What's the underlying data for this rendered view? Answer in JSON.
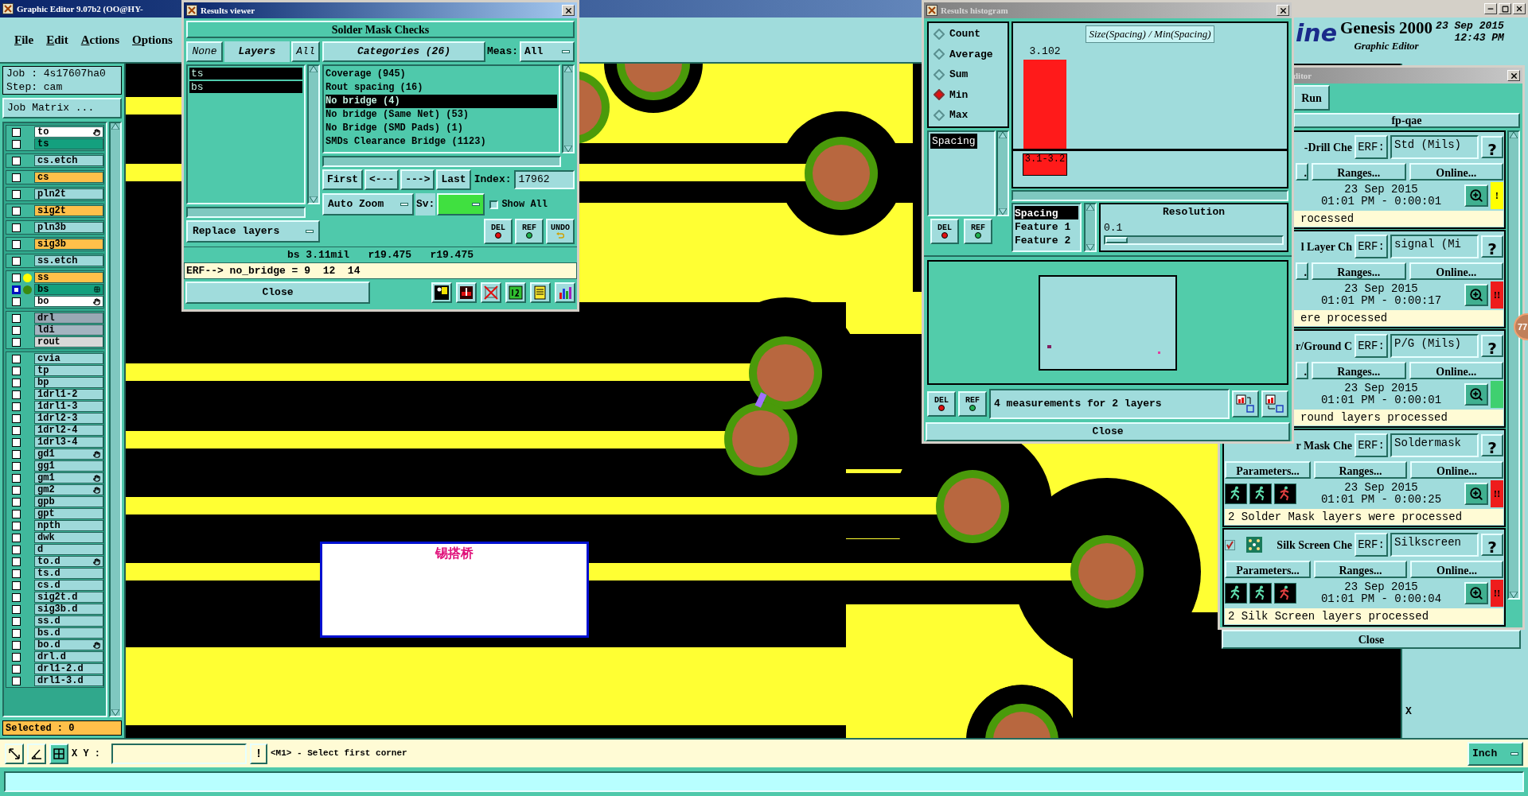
{
  "main_window": {
    "title": "Graphic Editor 9.07b2 (OO@HY-",
    "menu": [
      "File",
      "Edit",
      "Actions",
      "Options"
    ]
  },
  "left_panel": {
    "job": "Job : 4s17607ha0",
    "step": "Step: cam",
    "job_matrix_button": "Job Matrix ...",
    "layer_groups": [
      {
        "layers": [
          {
            "name": "to",
            "color": "#ffffff",
            "hand_mark": true,
            "selected": false
          },
          {
            "name": "ts",
            "color": "#14a07e",
            "selected": false
          }
        ]
      },
      {
        "layers": [
          {
            "name": "cs.etch",
            "color": "#9ed9da",
            "selected": false
          }
        ]
      },
      {
        "layers": [
          {
            "name": "cs",
            "color": "#ffc04a",
            "selected": false
          }
        ]
      },
      {
        "layers": [
          {
            "name": "pln2t",
            "color": "#9ed9da",
            "selected": false
          }
        ]
      },
      {
        "layers": [
          {
            "name": "sig2t",
            "color": "#ffc04a",
            "selected": false
          }
        ]
      },
      {
        "layers": [
          {
            "name": "pln3b",
            "color": "#9ed9da",
            "selected": false
          }
        ]
      },
      {
        "layers": [
          {
            "name": "sig3b",
            "color": "#ffc04a",
            "selected": false
          }
        ]
      },
      {
        "layers": [
          {
            "name": "ss.etch",
            "color": "#9ed9da",
            "selected": false
          }
        ]
      },
      {
        "layers": [
          {
            "name": "ss",
            "color": "#ffc04a",
            "dot": {
              "color": "#ffff00"
            },
            "selected": false
          },
          {
            "name": "bs",
            "color": "#14a07e",
            "dot": {
              "color": "#3a8a10"
            },
            "grid_mark": true,
            "selected": true
          },
          {
            "name": "bo",
            "color": "#ffffff",
            "hand_mark": true,
            "selected": false
          }
        ]
      },
      {
        "layers": [
          {
            "name": "drl",
            "color": "#98a8b4",
            "selected": false
          },
          {
            "name": "ldi",
            "color": "#a4b4c0",
            "selected": false
          },
          {
            "name": "rout",
            "color": "#d8d8d8",
            "selected": false
          }
        ]
      },
      {
        "layers": [
          {
            "name": "cvia",
            "color": "#9ed9da",
            "selected": false
          },
          {
            "name": "tp",
            "color": "#9ed9da",
            "selected": false
          },
          {
            "name": "bp",
            "color": "#9ed9da",
            "selected": false
          },
          {
            "name": "1drl1-2",
            "color": "#9ed9da",
            "selected": false
          },
          {
            "name": "1drl1-3",
            "color": "#9ed9da",
            "selected": false
          },
          {
            "name": "1drl2-3",
            "color": "#9ed9da",
            "selected": false
          },
          {
            "name": "1drl2-4",
            "color": "#9ed9da",
            "selected": false
          },
          {
            "name": "1drl3-4",
            "color": "#9ed9da",
            "selected": false
          },
          {
            "name": "gd1",
            "color": "#9ed9da",
            "hand_mark": true,
            "selected": false
          },
          {
            "name": "gg1",
            "color": "#9ed9da",
            "selected": false
          },
          {
            "name": "gm1",
            "color": "#9ed9da",
            "hand_mark": true,
            "selected": false
          },
          {
            "name": "gm2",
            "color": "#9ed9da",
            "hand_mark": true,
            "selected": false
          },
          {
            "name": "gpb",
            "color": "#9ed9da",
            "selected": false
          },
          {
            "name": "gpt",
            "color": "#9ed9da",
            "selected": false
          },
          {
            "name": "npth",
            "color": "#9ed9da",
            "selected": false
          },
          {
            "name": "dwk",
            "color": "#9ed9da",
            "selected": false
          },
          {
            "name": "d",
            "color": "#9ed9da",
            "selected": false
          },
          {
            "name": "to.d",
            "color": "#9ed9da",
            "hand_mark": true,
            "selected": false
          },
          {
            "name": "ts.d",
            "color": "#9ed9da",
            "selected": false
          },
          {
            "name": "cs.d",
            "color": "#9ed9da",
            "selected": false
          },
          {
            "name": "sig2t.d",
            "color": "#9ed9da",
            "selected": false
          },
          {
            "name": "sig3b.d",
            "color": "#9ed9da",
            "selected": false
          },
          {
            "name": "ss.d",
            "color": "#9ed9da",
            "selected": false
          },
          {
            "name": "bs.d",
            "color": "#9ed9da",
            "selected": false
          },
          {
            "name": "bo.d",
            "color": "#9ed9da",
            "hand_mark": true,
            "selected": false
          },
          {
            "name": "drl.d",
            "color": "#9ed9da",
            "selected": false
          },
          {
            "name": "drl1-2.d",
            "color": "#9ed9da",
            "selected": false
          },
          {
            "name": "drl1-3.d",
            "color": "#9ed9da",
            "selected": false
          }
        ]
      }
    ],
    "selected_count": "Selected : 0"
  },
  "canvas": {
    "annotation": "锡搭桥"
  },
  "results_viewer": {
    "title": "Results viewer",
    "heading": "Solder Mask Checks",
    "none_button": "None",
    "layers_label": "Layers",
    "all_button": "All",
    "layers": [
      {
        "name": "ts",
        "selected": true
      },
      {
        "name": "bs",
        "selected": true
      }
    ],
    "categories_label": "Categories (26)",
    "meas_label": "Meas:",
    "meas_value": "All",
    "categories": [
      {
        "label": "Coverage (945)",
        "selected": false
      },
      {
        "label": "Rout spacing (16)",
        "selected": false
      },
      {
        "label": "No bridge (4)",
        "selected": true
      },
      {
        "label": "No bridge (Same Net) (53)",
        "selected": false
      },
      {
        "label": "No Bridge (SMD Pads) (1)",
        "selected": false
      },
      {
        "label": "SMDs Clearance Bridge (1123)",
        "selected": false
      }
    ],
    "nav_buttons": [
      "First",
      "<---",
      "--->",
      "Last"
    ],
    "index_label": "Index:",
    "index_value": "17962",
    "zoom_mode": "Auto Zoom",
    "sv_label": "Sv:",
    "show_all": {
      "label": "Show All",
      "checked": false
    },
    "tool_buttons": [
      {
        "label": "DEL",
        "kind": "delete"
      },
      {
        "label": "REF",
        "kind": "reference"
      },
      {
        "label": "UNDO",
        "kind": "undo"
      }
    ],
    "replace_mode": "Replace layers",
    "info": "bs 3.11mil   r19.475   r19.475",
    "erf": "ERF--> no_bridge = 9  12  14",
    "close_button": "Close"
  },
  "results_histogram": {
    "title": "Results histogram",
    "modes": [
      {
        "label": "Count",
        "selected": false
      },
      {
        "label": "Average",
        "selected": false
      },
      {
        "label": "Sum",
        "selected": false
      },
      {
        "label": "Min",
        "selected": true
      },
      {
        "label": "Max",
        "selected": false
      }
    ],
    "measures": [
      {
        "label": "Spacing",
        "selected": true
      }
    ],
    "list_buttons": [
      {
        "label": "DEL",
        "kind": "delete"
      },
      {
        "label": "REF",
        "kind": "reference"
      }
    ],
    "chart_title": "Size(Spacing) / Min(Spacing)",
    "bars": [
      {
        "value_label": "3.102",
        "category": "3.1-3.2"
      }
    ],
    "fields": [
      {
        "label": "Spacing",
        "selected": true
      },
      {
        "label": "Feature 1",
        "selected": false
      },
      {
        "label": "Feature 2",
        "selected": false
      }
    ],
    "resolution_label": "Resolution",
    "resolution_value": "0.1",
    "resolution_slider": {
      "level": 0.0
    },
    "bottom_buttons": [
      {
        "label": "DEL",
        "kind": "delete"
      },
      {
        "label": "REF",
        "kind": "reference"
      }
    ],
    "summary": "4 measurements for 2 layers",
    "close_button": "Close"
  },
  "genesis_header": {
    "logo": "ine",
    "product": "Genesis 2000",
    "subtitle": "Graphic Editor",
    "date": "23 Sep 2015",
    "time": "12:43 PM"
  },
  "editor_window": {
    "title": "ditor",
    "run_button": "Run",
    "program": "fp-qae",
    "close_button": "Close",
    "checks": [
      {
        "kind": "covered",
        "name": "-Drill Che",
        "erf_label": "ERF:",
        "erf_value": "Std (Mils)",
        "help": "?",
        "parameters": ".",
        "ranges": "Ranges...",
        "online": "Online...",
        "date": "23 Sep 2015",
        "time": "01:01 PM - 0:00:01",
        "status": "!",
        "color": "#ffff00",
        "message": "rocessed"
      },
      {
        "kind": "covered",
        "name": "l Layer Ch",
        "erf_label": "ERF:",
        "erf_value": "signal (Mi",
        "help": "?",
        "parameters": ".",
        "ranges": "Ranges...",
        "online": "Online...",
        "date": "23 Sep 2015",
        "time": "01:01 PM - 0:00:17",
        "status": "!!",
        "color": "#ee1c1c",
        "message": "ere processed"
      },
      {
        "kind": "covered",
        "name": "r/Ground C",
        "erf_label": "ERF:",
        "erf_value": "P/G (Mils)",
        "help": "?",
        "parameters": ".",
        "ranges": "Ranges...",
        "online": "Online...",
        "date": "23 Sep 2015",
        "time": "01:01 PM - 0:00:01",
        "color": "#3fd070",
        "message": "round layers processed"
      },
      {
        "kind": "partly_covered",
        "name": "r Mask Che",
        "erf_label": "ERF:",
        "erf_value": "Soldermask",
        "help": "?",
        "parameters": "Parameters...",
        "ranges": "Ranges...",
        "online": "Online...",
        "date": "23 Sep 2015",
        "time": "01:01 PM - 0:00:25",
        "status": "!!",
        "color": "#ee1c1c",
        "message": "2 Solder Mask layers were processed"
      },
      {
        "kind": "full",
        "checked": true,
        "name": "Silk Screen Che",
        "erf_label": "ERF:",
        "erf_value": "Silkscreen",
        "help": "?",
        "parameters": "Parameters...",
        "ranges": "Ranges...",
        "online": "Online...",
        "date": "23 Sep 2015",
        "time": "01:01 PM - 0:00:04",
        "status": "!!",
        "color": "#ee1c1c",
        "message": "2 Silk Screen layers processed"
      }
    ]
  },
  "right_strip": {
    "label": "X"
  },
  "badge": "77",
  "bottom_bar": {
    "xy_label": "X Y :",
    "alert_button": "!",
    "prompt": "<M1> - Select first corner",
    "units": "Inch"
  }
}
